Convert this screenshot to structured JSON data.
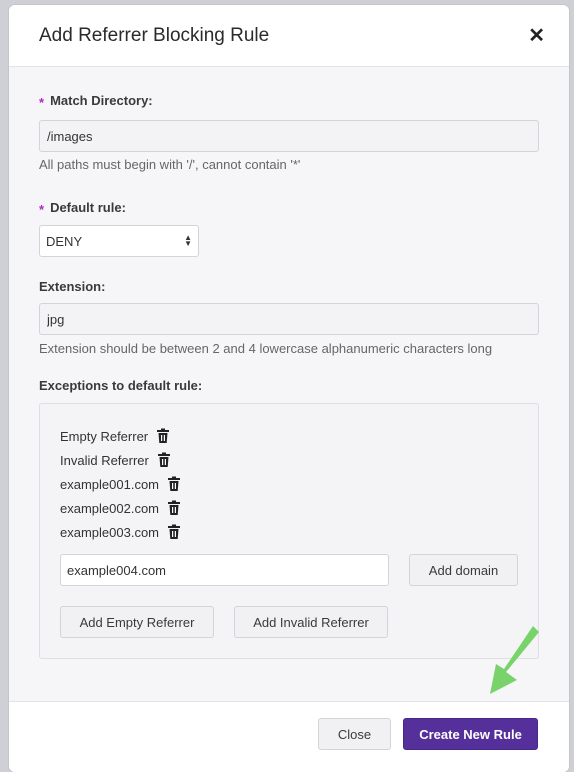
{
  "modal": {
    "title": "Add Referrer Blocking Rule",
    "close_icon": "close-icon"
  },
  "match_directory": {
    "label": "Match Directory:",
    "required": true,
    "value": "/images",
    "help": "All paths must begin with '/', cannot contain '*'"
  },
  "default_rule": {
    "label": "Default rule:",
    "required": true,
    "selected": "DENY"
  },
  "extension": {
    "label": "Extension:",
    "value": "jpg",
    "help": "Extension should be between 2 and 4 lowercase alphanumeric characters long"
  },
  "exceptions": {
    "label": "Exceptions to default rule:",
    "items": [
      {
        "label": "Empty Referrer",
        "icon": "trash-icon"
      },
      {
        "label": "Invalid Referrer",
        "icon": "trash-icon"
      },
      {
        "label": "example001.com",
        "icon": "trash-icon"
      },
      {
        "label": "example002.com",
        "icon": "trash-icon"
      },
      {
        "label": "example003.com",
        "icon": "trash-icon"
      }
    ],
    "domain_input_value": "example004.com",
    "add_domain_label": "Add domain",
    "add_empty_label": "Add Empty Referrer",
    "add_invalid_label": "Add Invalid Referrer"
  },
  "footer": {
    "close_label": "Close",
    "create_label": "Create New Rule"
  },
  "colors": {
    "primary": "#56309a",
    "required_marker": "#b02ac2",
    "annotation_arrow": "#77d36a"
  }
}
